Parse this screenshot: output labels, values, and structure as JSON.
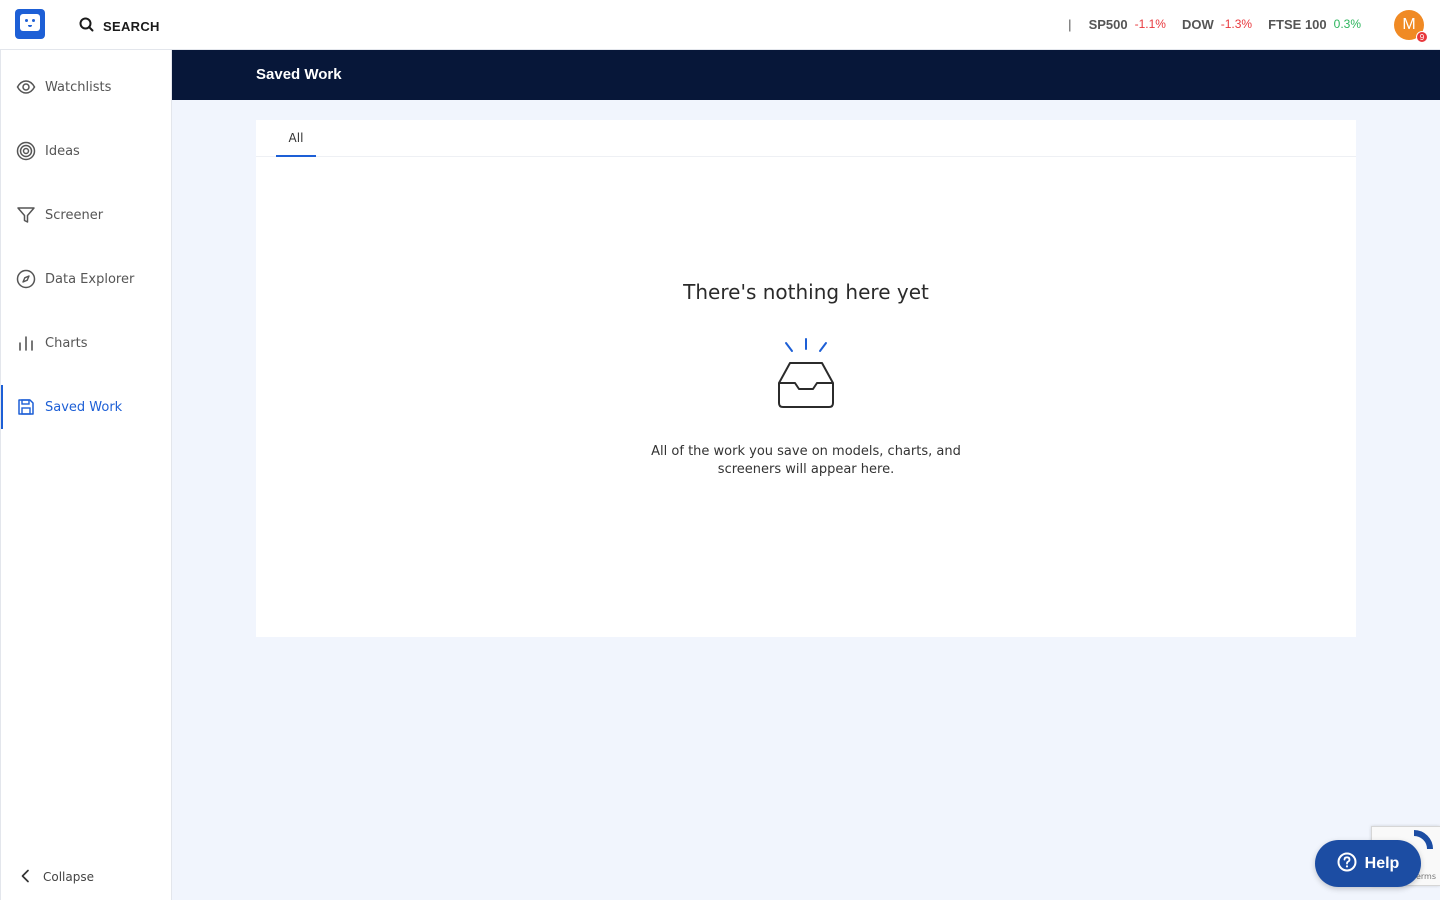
{
  "topbar": {
    "search_label": "SEARCH",
    "separator": "|",
    "tickers": [
      {
        "name": "SP500",
        "change": "-1.1%",
        "direction": "down"
      },
      {
        "name": "DOW",
        "change": "-1.3%",
        "direction": "down"
      },
      {
        "name": "FTSE 100",
        "change": "0.3%",
        "direction": "up"
      }
    ],
    "avatar_initial": "M",
    "notification_count": "9"
  },
  "sidebar": {
    "items": [
      {
        "label": "Watchlists",
        "icon": "eye-icon"
      },
      {
        "label": "Ideas",
        "icon": "target-icon"
      },
      {
        "label": "Screener",
        "icon": "filter-icon"
      },
      {
        "label": "Data Explorer",
        "icon": "compass-icon"
      },
      {
        "label": "Charts",
        "icon": "bar-chart-icon"
      },
      {
        "label": "Saved Work",
        "icon": "save-icon",
        "active": true
      }
    ],
    "collapse_label": "Collapse"
  },
  "header": {
    "title": "Saved Work"
  },
  "main": {
    "tabs": [
      {
        "label": "All",
        "active": true
      }
    ],
    "empty_state": {
      "title": "There's nothing here yet",
      "line1": "All of the work you save on models, charts, and",
      "line2": "screeners will appear here.",
      "icon": "inbox-tray-icon"
    }
  },
  "help": {
    "label": "Help"
  },
  "recaptcha": {
    "text": "erms"
  },
  "colors": {
    "accent": "#1d5fd6",
    "header_bg": "#071739",
    "negative": "#e8383d",
    "positive": "#2db55d",
    "avatar": "#f08a24",
    "page_bg": "#f1f5fd"
  }
}
